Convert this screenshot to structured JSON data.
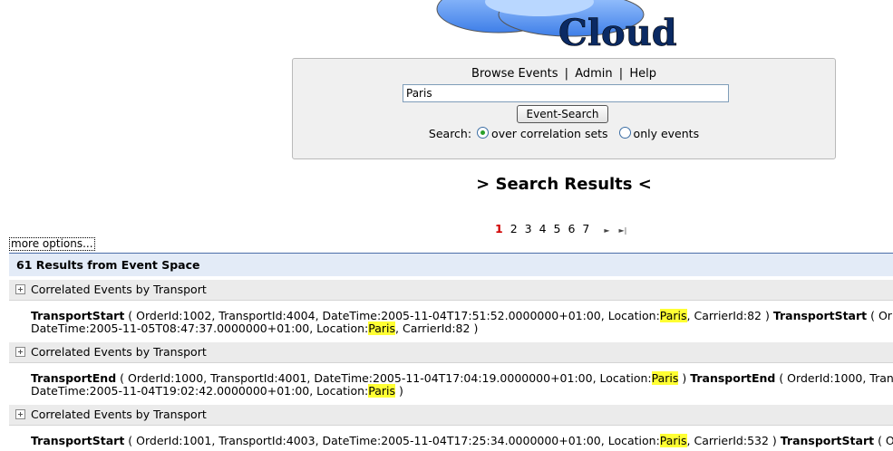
{
  "logo": {
    "text": "Cloud"
  },
  "nav": {
    "browse": "Browse Events",
    "admin": "Admin",
    "help": "Help",
    "separator": "|"
  },
  "search": {
    "value": "Paris",
    "button_label": "Event-Search",
    "mode_label": "Search:",
    "option_correlation": "over correlation sets",
    "option_events": "only events",
    "selected": "over correlation sets"
  },
  "results_title": "> Search Results <",
  "pager": {
    "current": "1",
    "pages": [
      "1",
      "2",
      "3",
      "4",
      "5",
      "6",
      "7"
    ],
    "next_icon": "next-icon",
    "last_icon": "last-icon"
  },
  "more_options": "more options...",
  "results_header": "61 Results from Event Space",
  "groups": [
    {
      "title": "Correlated Events by Transport",
      "line1_event": "TransportStart",
      "line1_pre": " ( OrderId:1002, TransportId:4004, DateTime:2005-11-04T17:51:52.0000000+01:00, Location:",
      "line1_hl": "Paris",
      "line1_post": ", CarrierId:82 ) ",
      "line1_event2": "TransportStart",
      "line1_tail": " ( Or",
      "line2_pre": "DateTime:2005-11-05T08:47:37.0000000+01:00, Location:",
      "line2_hl": "Paris",
      "line2_post": ", CarrierId:82 )"
    },
    {
      "title": "Correlated Events by Transport",
      "line1_event": "TransportEnd",
      "line1_pre": " ( OrderId:1000, TransportId:4001, DateTime:2005-11-04T17:04:19.0000000+01:00, Location:",
      "line1_hl": "Paris",
      "line1_post": " ) ",
      "line1_event2": "TransportEnd",
      "line1_tail": " ( OrderId:1000, Tran",
      "line2_pre": "DateTime:2005-11-04T19:02:42.0000000+01:00, Location:",
      "line2_hl": "Paris",
      "line2_post": " )"
    },
    {
      "title": "Correlated Events by Transport",
      "line1_event": "TransportStart",
      "line1_pre": " ( OrderId:1001, TransportId:4003, DateTime:2005-11-04T17:25:34.0000000+01:00, Location:",
      "line1_hl": "Paris",
      "line1_post": ", CarrierId:532 ) ",
      "line1_event2": "TransportStart",
      "line1_tail": " ( O"
    }
  ]
}
